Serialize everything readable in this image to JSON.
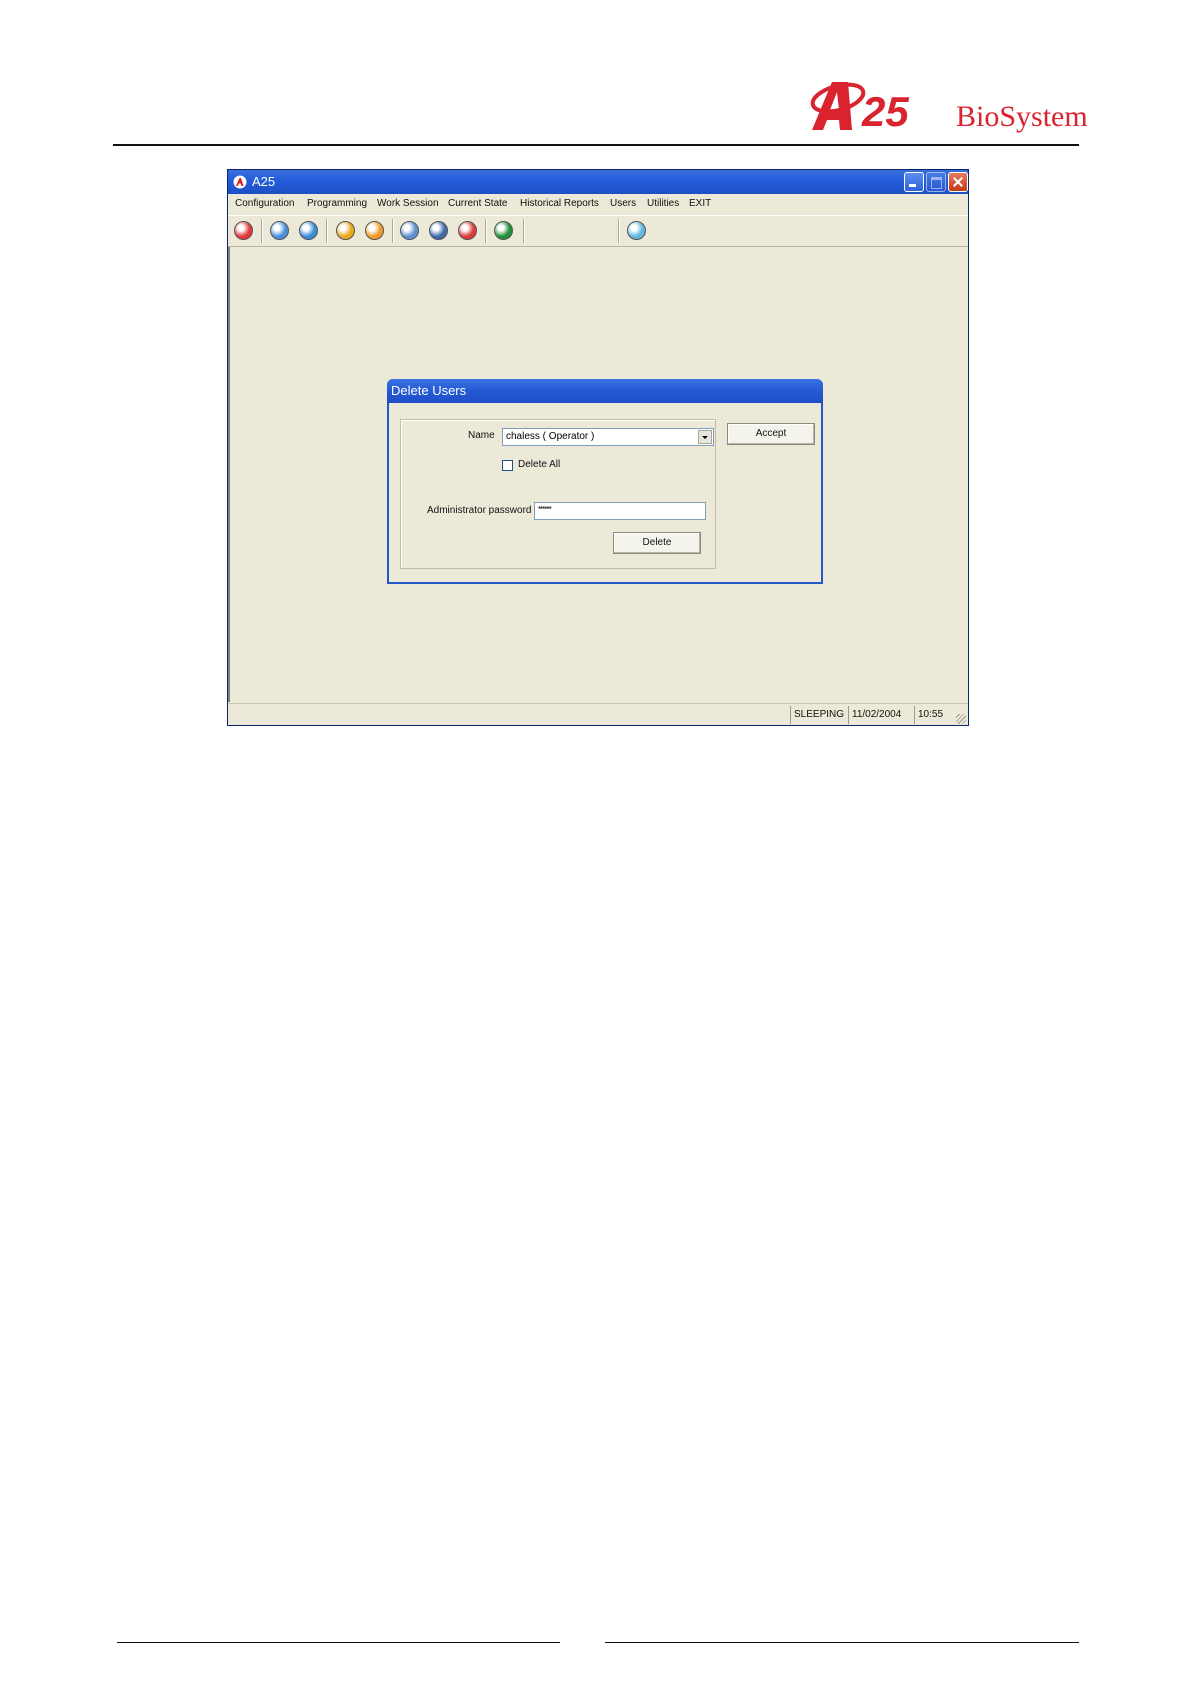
{
  "branding": {
    "logo_text": "A25",
    "company": "BioSystems",
    "brand_color": "#d9232e"
  },
  "window": {
    "title": "A25",
    "title_bar_color": "#245edb",
    "menu": [
      "Configuration",
      "Programming",
      "Work Session",
      "Current State",
      "Historical Reports",
      "Users",
      "Utilities",
      "EXIT"
    ],
    "toolbar_icons": [
      {
        "name": "a25-icon",
        "color": "#e0383b"
      },
      {
        "name": "snowflake-icon",
        "color": "#4a8fd8"
      },
      {
        "name": "globe-icon",
        "color": "#3a8ad6"
      },
      {
        "name": "reagent-icon",
        "color": "#e7a81a"
      },
      {
        "name": "rotor-icon",
        "color": "#f09a2a"
      },
      {
        "name": "disk-icon",
        "color": "#5f8fd0"
      },
      {
        "name": "results-icon",
        "color": "#3e6aa8"
      },
      {
        "name": "print-icon",
        "color": "#d93a3a"
      },
      {
        "name": "tools-icon",
        "color": "#1f8f3a"
      },
      {
        "name": "sun-icon",
        "color": "#5fb8e0"
      }
    ]
  },
  "dialog": {
    "title": "Delete Users",
    "name_label": "Name",
    "name_value": "chaless ( Operator )",
    "delete_all_label": "Delete All",
    "delete_all_checked": false,
    "password_label": "Administrator password",
    "password_value": "******",
    "delete_button": "Delete",
    "accept_button": "Accept"
  },
  "status": {
    "state": "SLEEPING",
    "date": "11/02/2004",
    "time": "10:55"
  }
}
